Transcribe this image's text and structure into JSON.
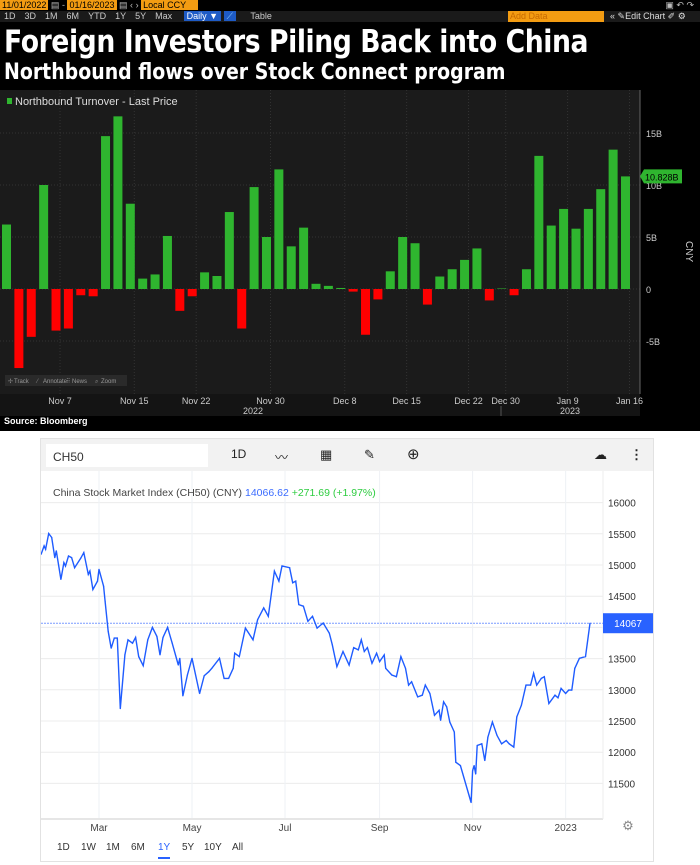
{
  "toolbar": {
    "start_date": "11/01/2022",
    "end_date": "01/16/2023",
    "currency": "Local CCY",
    "periods": [
      "1D",
      "3D",
      "1M",
      "6M",
      "YTD",
      "1Y",
      "5Y",
      "Max"
    ],
    "frequency": "Daily ▼",
    "table_label": "Table",
    "add_data_placeholder": "Add Data",
    "edit_chart": "Edit Chart"
  },
  "header": {
    "title": "Foreign Investors Piling Back into China",
    "subtitle": "Northbound flows over Stock Connect program"
  },
  "source": "Source: Bloomberg",
  "chart_tools": [
    "Track",
    "Annotate",
    "News",
    "Zoom"
  ],
  "widget": {
    "symbol": "CH50",
    "interval": "1D",
    "ranges": [
      "1D",
      "1W",
      "1M",
      "6M",
      "1Y",
      "5Y",
      "10Y",
      "All"
    ],
    "active_range": "1Y",
    "legend_name": "China Stock Market Index (CH50) (CNY)",
    "legend_price": "14066.62",
    "legend_change": "+271.69 (+1.97%)",
    "last_label": "14067"
  },
  "colors": {
    "positive": "#2fb52f",
    "negative": "#ff0000",
    "line": "#1f5cff",
    "price_text": "#3b6cff",
    "change_text": "#2ecc40",
    "accent": "#f39c12"
  },
  "chart_data": [
    {
      "type": "bar",
      "legend": "Northbound Turnover - Last Price",
      "ylabel": "CNY",
      "yunit": "B",
      "ylim": [
        -9,
        18
      ],
      "yticks": [
        "-5B",
        "0",
        "5B",
        "10B",
        "15B"
      ],
      "ytick_values": [
        -5,
        0,
        5,
        10,
        15
      ],
      "last_value_label": "10.828B",
      "grid": true,
      "x_ticks": [
        {
          "date": "2022-11-07",
          "label": "Nov 7"
        },
        {
          "date": "2022-11-15",
          "label": "Nov 15"
        },
        {
          "date": "2022-11-22",
          "label": "Nov 22"
        },
        {
          "date": "2022-11-30",
          "label": "Nov 30"
        },
        {
          "date": "2022-12-08",
          "label": "Dec 8"
        },
        {
          "date": "2022-12-15",
          "label": "Dec 15"
        },
        {
          "date": "2022-12-22",
          "label": "Dec 22"
        },
        {
          "date": "2022-12-30",
          "label": "Dec 30"
        },
        {
          "date": "2023-01-09",
          "label": "Jan 9"
        },
        {
          "date": "2023-01-16",
          "label": "Jan 16"
        }
      ],
      "year_labels": [
        "2022",
        "2023"
      ],
      "dates": [
        "2022-11-01",
        "2022-11-02",
        "2022-11-03",
        "2022-11-04",
        "2022-11-07",
        "2022-11-08",
        "2022-11-09",
        "2022-11-10",
        "2022-11-11",
        "2022-11-14",
        "2022-11-15",
        "2022-11-16",
        "2022-11-17",
        "2022-11-18",
        "2022-11-21",
        "2022-11-22",
        "2022-11-23",
        "2022-11-24",
        "2022-11-25",
        "2022-11-28",
        "2022-11-29",
        "2022-11-30",
        "2022-12-01",
        "2022-12-02",
        "2022-12-05",
        "2022-12-06",
        "2022-12-07",
        "2022-12-08",
        "2022-12-09",
        "2022-12-12",
        "2022-12-13",
        "2022-12-14",
        "2022-12-15",
        "2022-12-16",
        "2022-12-19",
        "2022-12-20",
        "2022-12-21",
        "2022-12-22",
        "2022-12-23",
        "2022-12-29",
        "2022-12-30",
        "2023-01-03",
        "2023-01-04",
        "2023-01-05",
        "2023-01-06",
        "2023-01-09",
        "2023-01-10",
        "2023-01-11",
        "2023-01-12",
        "2023-01-13",
        "2023-01-16"
      ],
      "values": [
        6.2,
        -7.6,
        -4.6,
        10.0,
        -4.0,
        -3.8,
        -0.6,
        -0.7,
        14.7,
        16.6,
        8.2,
        1.0,
        1.4,
        5.1,
        -2.1,
        -0.7,
        1.6,
        1.25,
        7.4,
        -3.8,
        9.8,
        5.0,
        11.5,
        4.1,
        5.9,
        0.5,
        0.3,
        0.1,
        -0.25,
        -4.4,
        -1.0,
        1.7,
        5.0,
        4.4,
        -1.5,
        1.2,
        1.9,
        2.8,
        3.9,
        -1.1,
        0.05,
        -0.6,
        1.9,
        12.8,
        6.1,
        7.7,
        5.8,
        7.7,
        9.6,
        13.4,
        10.828
      ]
    },
    {
      "type": "line",
      "ylim": [
        11000,
        16300
      ],
      "yticks": [
        11500,
        12000,
        12500,
        13000,
        13500,
        14000,
        14500,
        15000,
        15500,
        16000
      ],
      "ytick_labels": [
        "11500",
        "12000",
        "12500",
        "13000",
        "13500",
        "",
        "14500",
        "15000",
        "15500",
        "16000"
      ],
      "grid": true,
      "x_ticks": [
        {
          "date": "2022-03-01",
          "label": "Mar"
        },
        {
          "date": "2022-05-01",
          "label": "May"
        },
        {
          "date": "2022-07-01",
          "label": "Jul"
        },
        {
          "date": "2022-09-01",
          "label": "Sep"
        },
        {
          "date": "2022-11-01",
          "label": "Nov"
        },
        {
          "date": "2023-01-01",
          "label": "2023"
        }
      ],
      "points": [
        [
          "2022-01-22",
          15172
        ],
        [
          "2022-01-24",
          15306
        ],
        [
          "2022-01-25",
          15253
        ],
        [
          "2022-01-27",
          15505
        ],
        [
          "2022-01-29",
          15441
        ],
        [
          "2022-01-31",
          15118
        ],
        [
          "2022-02-01",
          15226
        ],
        [
          "2022-02-04",
          14769
        ],
        [
          "2022-02-06",
          15038
        ],
        [
          "2022-02-07",
          14984
        ],
        [
          "2022-02-09",
          15145
        ],
        [
          "2022-02-11",
          15118
        ],
        [
          "2022-02-13",
          14957
        ],
        [
          "2022-02-17",
          15108
        ],
        [
          "2022-02-19",
          15199
        ],
        [
          "2022-02-22",
          14849
        ],
        [
          "2022-02-23",
          14903
        ],
        [
          "2022-02-25",
          14608
        ],
        [
          "2022-02-28",
          14742
        ],
        [
          "2022-03-01",
          14930
        ],
        [
          "2022-03-04",
          14661
        ],
        [
          "2022-03-05",
          14419
        ],
        [
          "2022-03-07",
          13936
        ],
        [
          "2022-03-09",
          13667
        ],
        [
          "2022-03-11",
          13828
        ],
        [
          "2022-03-13",
          13828
        ],
        [
          "2022-03-15",
          12699
        ],
        [
          "2022-03-18",
          13559
        ],
        [
          "2022-03-20",
          13801
        ],
        [
          "2022-03-23",
          13747
        ],
        [
          "2022-03-25",
          13839
        ],
        [
          "2022-03-27",
          13532
        ],
        [
          "2022-03-30",
          13387
        ],
        [
          "2022-04-02",
          13801
        ],
        [
          "2022-04-05",
          14000
        ],
        [
          "2022-04-08",
          13855
        ],
        [
          "2022-04-10",
          13559
        ],
        [
          "2022-04-12",
          13839
        ],
        [
          "2022-04-15",
          14000
        ],
        [
          "2022-04-18",
          13747
        ],
        [
          "2022-04-22",
          13398
        ],
        [
          "2022-04-23",
          13505
        ],
        [
          "2022-04-25",
          12903
        ],
        [
          "2022-04-28",
          13237
        ],
        [
          "2022-05-01",
          13505
        ],
        [
          "2022-05-06",
          12941
        ],
        [
          "2022-05-09",
          13226
        ],
        [
          "2022-05-12",
          13290
        ],
        [
          "2022-05-14",
          13344
        ],
        [
          "2022-05-19",
          13505
        ],
        [
          "2022-05-22",
          13183
        ],
        [
          "2022-05-25",
          13183
        ],
        [
          "2022-05-28",
          13344
        ],
        [
          "2022-05-29",
          13586
        ],
        [
          "2022-06-01",
          13532
        ],
        [
          "2022-06-05",
          13989
        ],
        [
          "2022-06-10",
          13801
        ],
        [
          "2022-06-13",
          14124
        ],
        [
          "2022-06-17",
          14312
        ],
        [
          "2022-06-20",
          14178
        ],
        [
          "2022-06-24",
          14903
        ],
        [
          "2022-06-27",
          14742
        ],
        [
          "2022-06-29",
          14984
        ],
        [
          "2022-07-04",
          14957
        ],
        [
          "2022-07-06",
          14715
        ],
        [
          "2022-07-08",
          14742
        ],
        [
          "2022-07-10",
          14366
        ],
        [
          "2022-07-13",
          14339
        ],
        [
          "2022-07-16",
          14097
        ],
        [
          "2022-07-19",
          14178
        ],
        [
          "2022-07-22",
          13989
        ],
        [
          "2022-07-26",
          14070
        ],
        [
          "2022-07-30",
          13909
        ],
        [
          "2022-08-01",
          13721
        ],
        [
          "2022-08-04",
          13371
        ],
        [
          "2022-08-08",
          13613
        ],
        [
          "2022-08-12",
          13398
        ],
        [
          "2022-08-15",
          13677
        ],
        [
          "2022-08-18",
          13640
        ],
        [
          "2022-08-20",
          13801
        ],
        [
          "2022-08-22",
          13613
        ],
        [
          "2022-08-24",
          13677
        ],
        [
          "2022-08-27",
          13425
        ],
        [
          "2022-08-30",
          13586
        ],
        [
          "2022-09-01",
          13452
        ],
        [
          "2022-09-04",
          13559
        ],
        [
          "2022-09-05",
          13344
        ],
        [
          "2022-09-09",
          13237
        ],
        [
          "2022-09-12",
          13210
        ],
        [
          "2022-09-15",
          13532
        ],
        [
          "2022-09-18",
          13344
        ],
        [
          "2022-09-20",
          13075
        ],
        [
          "2022-09-22",
          13129
        ],
        [
          "2022-09-26",
          12887
        ],
        [
          "2022-09-29",
          12914
        ],
        [
          "2022-10-01",
          13075
        ],
        [
          "2022-10-04",
          12941
        ],
        [
          "2022-10-07",
          12592
        ],
        [
          "2022-10-10",
          12672
        ],
        [
          "2022-10-11",
          12511
        ],
        [
          "2022-10-13",
          12807
        ],
        [
          "2022-10-15",
          12726
        ],
        [
          "2022-10-17",
          12484
        ],
        [
          "2022-10-20",
          12323
        ],
        [
          "2022-10-21",
          11839
        ],
        [
          "2022-10-24",
          11785
        ],
        [
          "2022-10-31",
          11194
        ],
        [
          "2022-11-01",
          11704
        ],
        [
          "2022-11-02",
          11785
        ],
        [
          "2022-11-03",
          11651
        ],
        [
          "2022-11-04",
          12108
        ],
        [
          "2022-11-07",
          12135
        ],
        [
          "2022-11-09",
          11866
        ],
        [
          "2022-11-11",
          12242
        ],
        [
          "2022-11-14",
          12484
        ],
        [
          "2022-11-17",
          12269
        ],
        [
          "2022-11-20",
          12135
        ],
        [
          "2022-11-23",
          12188
        ],
        [
          "2022-11-25",
          12135
        ],
        [
          "2022-11-28",
          12081
        ],
        [
          "2022-11-30",
          12565
        ],
        [
          "2022-12-03",
          12753
        ],
        [
          "2022-12-06",
          13075
        ],
        [
          "2022-12-09",
          13075
        ],
        [
          "2022-12-11",
          13264
        ],
        [
          "2022-12-13",
          13075
        ],
        [
          "2022-12-16",
          13183
        ],
        [
          "2022-12-18",
          13210
        ],
        [
          "2022-12-21",
          12780
        ],
        [
          "2022-12-25",
          12914
        ],
        [
          "2022-12-27",
          12871
        ],
        [
          "2022-12-29",
          13022
        ],
        [
          "2023-01-01",
          12941
        ],
        [
          "2023-01-03",
          12995
        ],
        [
          "2023-01-05",
          12995
        ],
        [
          "2023-01-07",
          13344
        ],
        [
          "2023-01-10",
          13505
        ],
        [
          "2023-01-14",
          13532
        ],
        [
          "2023-01-17",
          14067
        ]
      ]
    }
  ]
}
